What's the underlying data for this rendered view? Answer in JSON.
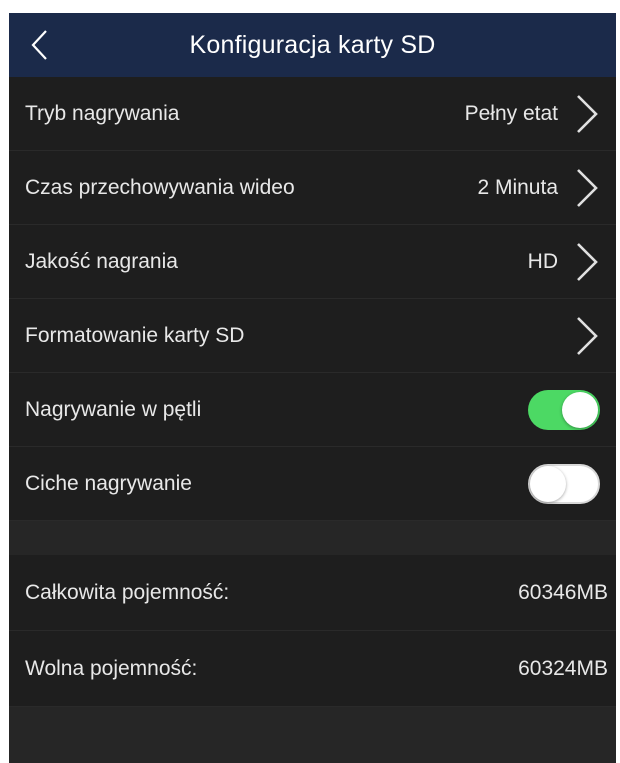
{
  "header": {
    "title": "Konfiguracja karty SD",
    "back_icon": "chevron-left-icon"
  },
  "settings": [
    {
      "label": "Tryb nagrywania",
      "value": "Pełny etat"
    },
    {
      "label": "Czas przechowywania wideo",
      "value": "2 Minuta"
    },
    {
      "label": "Jakość nagrania",
      "value": "HD"
    },
    {
      "label": "Formatowanie karty SD",
      "value": ""
    }
  ],
  "toggles": [
    {
      "label": "Nagrywanie w pętli",
      "state": "on"
    },
    {
      "label": "Ciche nagrywanie",
      "state": "off"
    }
  ],
  "capacity": {
    "total_label": "Całkowita pojemność:",
    "total_value": "60346MB",
    "free_label": "Wolna pojemność:",
    "free_value": "60324MB"
  },
  "colors": {
    "header_bg": "#1b2a4a",
    "row_bg": "#1e1e1e",
    "toggle_on": "#4cd964",
    "toggle_off": "#ffffff"
  }
}
